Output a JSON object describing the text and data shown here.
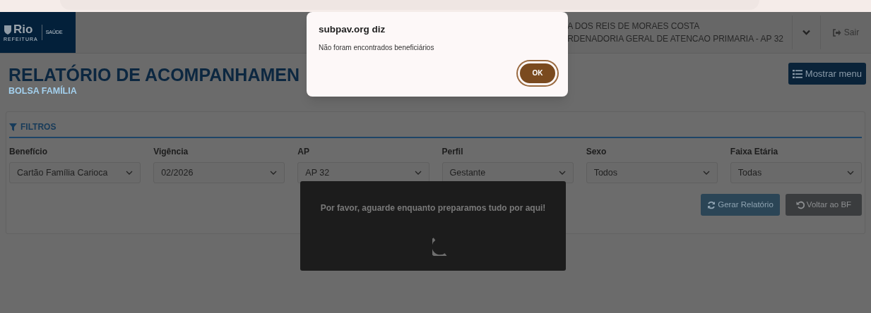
{
  "header": {
    "logo_text": "Rio",
    "logo_caption": "REFEITURA",
    "logo_section": "SAÚDE",
    "user_name": "A DOS REIS DE MORAES COSTA",
    "user_unit": "RDENADORIA GERAL DE ATENCAO PRIMARIA - AP 32",
    "logout": "Sair"
  },
  "page": {
    "title": "RELATÓRIO DE ACOMPANHAMEN",
    "subtitle": "BOLSA FAMÍLIA",
    "menu_button": "Mostrar menu"
  },
  "filters": {
    "title": "FILTROS",
    "fields": [
      {
        "label": "Benefício",
        "value": "Cartão Família Carioca"
      },
      {
        "label": "Vigência",
        "value": "02/2026"
      },
      {
        "label": "AP",
        "value": "AP 32"
      },
      {
        "label": "Perfil",
        "value": "Gestante"
      },
      {
        "label": "Sexo",
        "value": "Todos"
      },
      {
        "label": "Faixa Etária",
        "value": "Todas"
      }
    ]
  },
  "actions": [
    {
      "label": "Gerar Relatório",
      "kind": "generate"
    },
    {
      "label": "Voltar ao BF",
      "kind": "back"
    }
  ],
  "loading": {
    "message": "Por favor, aguarde enquanto preparamos tudo por aqui!"
  },
  "dialog": {
    "title": "subpav.org diz",
    "message": "Não foram encontrados beneficiários",
    "button": "OK"
  }
}
